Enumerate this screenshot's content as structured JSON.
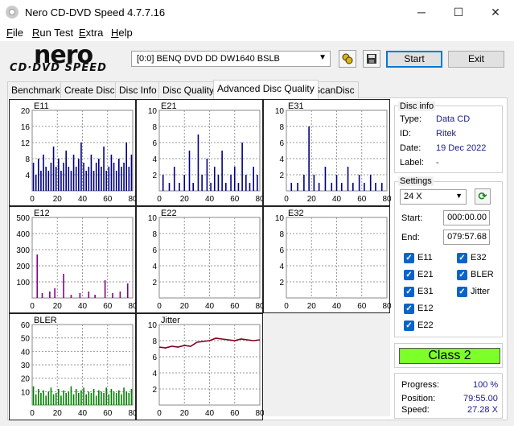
{
  "window": {
    "title": "Nero CD-DVD Speed 4.7.7.16",
    "minimize_glyph": "─",
    "maximize_glyph": "☐",
    "close_glyph": "✕"
  },
  "menu": {
    "items": [
      {
        "label": "File",
        "key": "F",
        "rest": "ile"
      },
      {
        "label": "Run Test",
        "key": "R",
        "rest": "un Test"
      },
      {
        "label": "Extra",
        "key": "E",
        "rest": "xtra"
      },
      {
        "label": "Help",
        "key": "H",
        "rest": "elp"
      }
    ]
  },
  "logo": {
    "brand": "nero",
    "product": "CD·DVD SPEED"
  },
  "toolbar": {
    "drive": "[0:0]   BENQ DVD DD DW1640 BSLB",
    "start_label": "Start",
    "exit_label": "Exit",
    "icons": [
      "drive-info-icon",
      "save-icon"
    ]
  },
  "tabs": [
    "Benchmark",
    "Create Disc",
    "Disc Info",
    "Disc Quality",
    "Advanced Disc Quality",
    "ScanDisc"
  ],
  "active_tab": "Advanced Disc Quality",
  "disc_info": {
    "title": "Disc info",
    "type_label": "Type:",
    "type": "Data CD",
    "id_label": "ID:",
    "id": "Ritek",
    "date_label": "Date:",
    "date": "19 Dec 2022",
    "label_label": "Label:",
    "label": "-"
  },
  "settings": {
    "title": "Settings",
    "speed": "24 X",
    "start_label": "Start:",
    "start": "000:00.00",
    "end_label": "End:",
    "end": "079:57.68",
    "checks": [
      {
        "label": "E11",
        "checked": true
      },
      {
        "label": "E32",
        "checked": true
      },
      {
        "label": "E21",
        "checked": true
      },
      {
        "label": "BLER",
        "checked": true
      },
      {
        "label": "E31",
        "checked": true
      },
      {
        "label": "Jitter",
        "checked": true
      },
      {
        "label": "E12",
        "checked": true
      },
      {
        "label": "E22",
        "checked": true
      }
    ]
  },
  "result": {
    "class": "Class 2",
    "color": "#7dff2a"
  },
  "progress": {
    "progress_label": "Progress:",
    "progress": "100 %",
    "position_label": "Position:",
    "position": "79:55.00",
    "speed_label": "Speed:",
    "speed": "27.28 X"
  },
  "chart_data": [
    {
      "name": "E11",
      "type": "bar",
      "ylim": [
        0,
        20
      ],
      "yticks": [
        4,
        8,
        12,
        16,
        20
      ],
      "xlim": [
        0,
        80
      ],
      "xticks": [
        0,
        20,
        40,
        60,
        80
      ],
      "color": "#000080",
      "x": [
        1,
        3,
        5,
        7,
        9,
        11,
        13,
        15,
        17,
        19,
        21,
        23,
        25,
        27,
        29,
        31,
        33,
        35,
        37,
        39,
        41,
        43,
        45,
        47,
        49,
        51,
        53,
        55,
        57,
        59,
        61,
        63,
        65,
        67,
        69,
        71,
        73,
        75,
        77,
        79
      ],
      "values": [
        7,
        4,
        8,
        5,
        9,
        6,
        5,
        7,
        11,
        6,
        8,
        5,
        7,
        10,
        6,
        5,
        9,
        6,
        8,
        12,
        7,
        5,
        6,
        9,
        5,
        7,
        8,
        6,
        11,
        5,
        6,
        9,
        7,
        5,
        8,
        6,
        7,
        12,
        6,
        9
      ]
    },
    {
      "name": "E21",
      "type": "bar",
      "ylim": [
        0,
        10
      ],
      "yticks": [
        2,
        4,
        6,
        8,
        10
      ],
      "xlim": [
        0,
        80
      ],
      "xticks": [
        0,
        20,
        40,
        60,
        80
      ],
      "color": "#000080",
      "x": [
        3,
        8,
        12,
        16,
        20,
        24,
        27,
        31,
        34,
        38,
        41,
        44,
        47,
        50,
        53,
        57,
        60,
        63,
        66,
        69,
        72,
        75,
        78
      ],
      "values": [
        2,
        1,
        3,
        1,
        2,
        5,
        1,
        7,
        2,
        4,
        1,
        3,
        2,
        5,
        1,
        2,
        3,
        1,
        6,
        2,
        1,
        3,
        2
      ]
    },
    {
      "name": "E31",
      "type": "bar",
      "ylim": [
        0,
        10
      ],
      "yticks": [
        2,
        4,
        6,
        8,
        10
      ],
      "xlim": [
        0,
        80
      ],
      "xticks": [
        0,
        20,
        40,
        60,
        80
      ],
      "color": "#000080",
      "x": [
        4,
        9,
        14,
        18,
        22,
        26,
        31,
        36,
        40,
        44,
        49,
        53,
        58,
        62,
        67,
        71,
        76
      ],
      "values": [
        1,
        1,
        2,
        8,
        2,
        1,
        3,
        1,
        2,
        1,
        3,
        1,
        2,
        1,
        2,
        1,
        1
      ]
    },
    {
      "name": "E12",
      "type": "bar",
      "ylim": [
        0,
        500
      ],
      "yticks": [
        100,
        200,
        300,
        400,
        500
      ],
      "xlim": [
        0,
        80
      ],
      "xticks": [
        0,
        20,
        40,
        60,
        80
      ],
      "color": "#800080",
      "x": [
        4,
        8,
        14,
        18,
        25,
        31,
        38,
        45,
        50,
        58,
        64,
        70,
        76
      ],
      "values": [
        270,
        30,
        40,
        60,
        150,
        20,
        30,
        40,
        20,
        110,
        30,
        40,
        90
      ]
    },
    {
      "name": "E22",
      "type": "bar",
      "ylim": [
        0,
        10
      ],
      "yticks": [
        2,
        4,
        6,
        8,
        10
      ],
      "xlim": [
        0,
        80
      ],
      "xticks": [
        0,
        20,
        40,
        60,
        80
      ],
      "color": "#000080",
      "x": [],
      "values": []
    },
    {
      "name": "E32",
      "type": "bar",
      "ylim": [
        0,
        10
      ],
      "yticks": [
        2,
        4,
        6,
        8,
        10
      ],
      "xlim": [
        0,
        80
      ],
      "xticks": [
        0,
        20,
        40,
        60,
        80
      ],
      "color": "#000080",
      "x": [],
      "values": []
    },
    {
      "name": "BLER",
      "type": "bar",
      "ylim": [
        0,
        60
      ],
      "yticks": [
        10,
        20,
        30,
        40,
        50,
        60
      ],
      "xlim": [
        0,
        80
      ],
      "xticks": [
        0,
        20,
        40,
        60,
        80
      ],
      "color": "#008000",
      "x": [
        1,
        3,
        5,
        7,
        9,
        11,
        13,
        15,
        17,
        19,
        21,
        23,
        25,
        27,
        29,
        31,
        33,
        35,
        37,
        39,
        41,
        43,
        45,
        47,
        49,
        51,
        53,
        55,
        57,
        59,
        61,
        63,
        65,
        67,
        69,
        71,
        73,
        75,
        77,
        79
      ],
      "values": [
        14,
        8,
        12,
        9,
        11,
        7,
        10,
        13,
        8,
        9,
        12,
        7,
        11,
        9,
        10,
        14,
        8,
        12,
        9,
        11,
        13,
        8,
        10,
        9,
        12,
        7,
        11,
        10,
        9,
        13,
        8,
        12,
        10,
        9,
        11,
        8,
        13,
        10,
        9,
        12
      ]
    },
    {
      "name": "Jitter",
      "type": "line",
      "ylim": [
        0,
        10
      ],
      "yticks": [
        2,
        4,
        6,
        8,
        10
      ],
      "xlim": [
        0,
        80
      ],
      "xticks": [
        0,
        20,
        40,
        60,
        80
      ],
      "color": "#800020",
      "x": [
        0,
        5,
        10,
        15,
        20,
        25,
        30,
        35,
        40,
        45,
        50,
        55,
        60,
        65,
        70,
        75,
        80
      ],
      "values": [
        7.2,
        7.1,
        7.3,
        7.2,
        7.4,
        7.3,
        7.8,
        7.9,
        8.0,
        8.3,
        8.2,
        8.1,
        8.0,
        8.2,
        8.1,
        8.0,
        8.1
      ]
    }
  ]
}
